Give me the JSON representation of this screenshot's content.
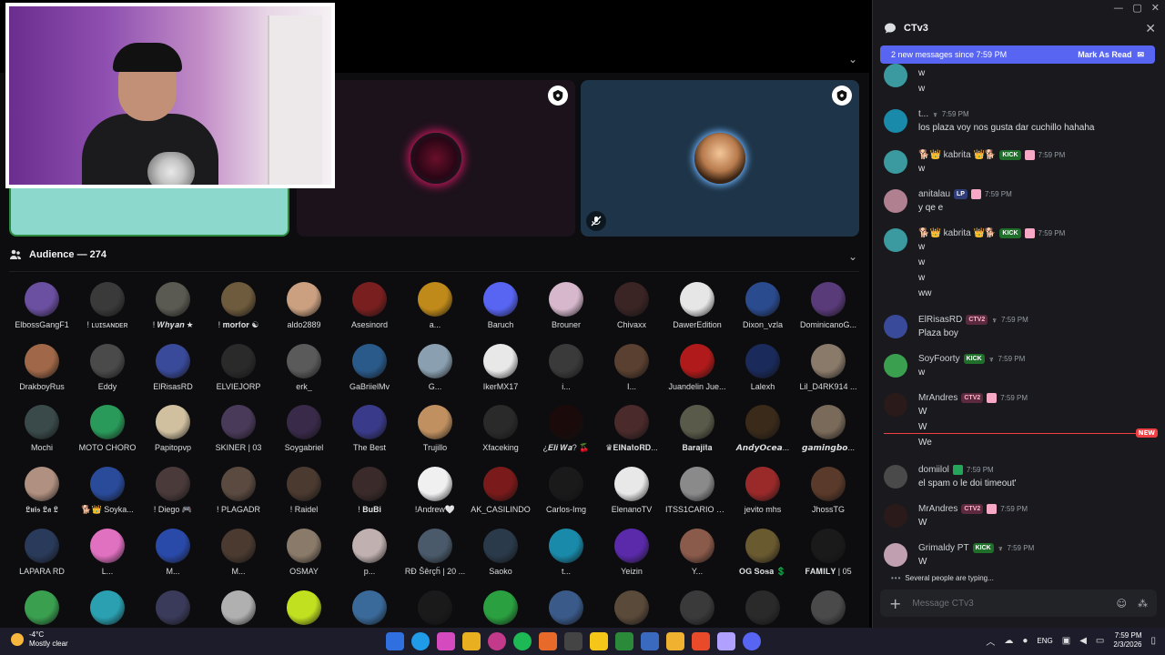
{
  "stage": {
    "audience_title": "Audience — 274"
  },
  "audience": [
    {
      "name": "ElbossGangF1",
      "color": "#6b4fa0"
    },
    {
      "name": "! ʟᴜɪsᴀɴᴅᴇʀ",
      "color": "#3a3a3a"
    },
    {
      "name": "! 𝑾𝒉𝒚𝒂𝒏 ★",
      "color": "#5a5a52"
    },
    {
      "name": "! 𝐦𝐨𝐫𝐟𝐨𝐫 ☯",
      "color": "#6e5a3c"
    },
    {
      "name": "aldo2889",
      "color": "#caa080"
    },
    {
      "name": "Asesinord",
      "color": "#7a1f1f"
    },
    {
      "name": "a...",
      "color": "#c08a1a"
    },
    {
      "name": "Baruch",
      "color": "#5865f2"
    },
    {
      "name": "Brouner",
      "color": "#d6b7cc"
    },
    {
      "name": "Chivaxx",
      "color": "#3a2424"
    },
    {
      "name": "DawerEdition",
      "color": "#e6e6e6"
    },
    {
      "name": "Dixon_vzla",
      "color": "#2b4b8f"
    },
    {
      "name": "DominicanoG...",
      "color": "#5a3b7a"
    },
    {
      "name": "DrakboyRus",
      "color": "#a06848"
    },
    {
      "name": "Eddy",
      "color": "#4a4a4a"
    },
    {
      "name": "ElRisasRD",
      "color": "#3a4a9a"
    },
    {
      "name": "ELVIEJORP",
      "color": "#2a2a2a"
    },
    {
      "name": "erk_",
      "color": "#5a5a5a"
    },
    {
      "name": "GaBriielMv",
      "color": "#2a5a8a"
    },
    {
      "name": "G...",
      "color": "#8aa0b0"
    },
    {
      "name": "IkerMX17",
      "color": "#e8e8e8"
    },
    {
      "name": "i...",
      "color": "#3a3a3a"
    },
    {
      "name": "I...",
      "color": "#5a4030"
    },
    {
      "name": "Juandelin Jue...",
      "color": "#b01a1a"
    },
    {
      "name": "Lalexh",
      "color": "#1a2a5a"
    },
    {
      "name": "Lil_D4RK914 ...",
      "color": "#8a7a6a"
    },
    {
      "name": "Mochi",
      "color": "#3a4a4a"
    },
    {
      "name": "MOTO CHORO",
      "color": "#2a9a5a"
    },
    {
      "name": "Papitopvp",
      "color": "#d0c0a0"
    },
    {
      "name": "SKINER | 03",
      "color": "#4a3a5a"
    },
    {
      "name": "Soygabriel",
      "color": "#3a2a4a"
    },
    {
      "name": "The Best",
      "color": "#3a3a8a"
    },
    {
      "name": "Trujillo",
      "color": "#c09060"
    },
    {
      "name": "Xfaceking",
      "color": "#2a2a2a"
    },
    {
      "name": "¿𝑬𝒍𝒊 𝑾𝒂? 🍒",
      "color": "#1a0a0a"
    },
    {
      "name": "♛𝐄𝐥𝐍𝐚𝐭𝐨𝐑𝐃...",
      "color": "#4a2a2a"
    },
    {
      "name": "𝐁𝐚𝐫𝐚𝐣𝐢𝐭𝐚",
      "color": "#5a5a4a"
    },
    {
      "name": "𝘼𝙣𝙙𝙮𝙊𝙘𝙚𝙖...",
      "color": "#3a2a1a"
    },
    {
      "name": "𝙜𝙖𝙢𝙞𝙣𝙜𝙗𝙤...",
      "color": "#7a6a5a"
    },
    {
      "name": "𝕷𝖚𝖎𝖘 𝕷𝖆 𝕷",
      "color": "#b09080"
    },
    {
      "name": "🐕👑 Soyka...",
      "color": "#2a4a9a"
    },
    {
      "name": "! Diego 🎮",
      "color": "#4a3a3a"
    },
    {
      "name": "! PLAGADR",
      "color": "#5a4a40"
    },
    {
      "name": "! Raidel",
      "color": "#4a3a30"
    },
    {
      "name": "! 𝐁𝐮𝐁𝐢",
      "color": "#3a2a2a"
    },
    {
      "name": "!Andrew🤍",
      "color": "#f0f0f0"
    },
    {
      "name": "AK_CASILINDO",
      "color": "#7a1a1a"
    },
    {
      "name": "Carlos-Img",
      "color": "#1a1a1a"
    },
    {
      "name": "ElenanoTV",
      "color": "#e8e8e8"
    },
    {
      "name": "ITSS1CARIO O...",
      "color": "#8a8a8a"
    },
    {
      "name": "jevito mhs",
      "color": "#9a2a2a"
    },
    {
      "name": "JhossTG",
      "color": "#5a3a2a"
    },
    {
      "name": "LAPARA RD",
      "color": "#2a3a5a"
    },
    {
      "name": "L...",
      "color": "#e070c0"
    },
    {
      "name": "M...",
      "color": "#2a4aaa"
    },
    {
      "name": "M...",
      "color": "#4a3a30"
    },
    {
      "name": "OSMAY",
      "color": "#8a7a6a"
    },
    {
      "name": "p...",
      "color": "#c0b0b0"
    },
    {
      "name": "RĐ Šêrçĥ | 20 ...",
      "color": "#4a5a6a"
    },
    {
      "name": "Saoko",
      "color": "#2a3a4a"
    },
    {
      "name": "t...",
      "color": "#1a8aaa"
    },
    {
      "name": "Yeizin",
      "color": "#5a2aaa"
    },
    {
      "name": "Y...",
      "color": "#8a5a4a"
    },
    {
      "name": "𝐎𝐆 𝐒𝐨𝐬𝐚 💲",
      "color": "#6a5a30"
    },
    {
      "name": "𝐅𝐀𝐌𝐈𝐋𝐘 | 05",
      "color": "#1a1a1a"
    },
    {
      "name": "...",
      "color": "#3aa050"
    },
    {
      "name": "...",
      "color": "#2aa0b0"
    },
    {
      "name": "...",
      "color": "#3a3a5a"
    },
    {
      "name": "...",
      "color": "#b0b0b0"
    },
    {
      "name": "...",
      "color": "#c0e020"
    },
    {
      "name": "...",
      "color": "#3a6a9a"
    },
    {
      "name": "...",
      "color": "#1a1a1a"
    },
    {
      "name": "...",
      "color": "#2aa040"
    },
    {
      "name": "...",
      "color": "#3a5a8a"
    },
    {
      "name": "...",
      "color": "#5a4a3a"
    },
    {
      "name": "...",
      "color": "#3a3a3a"
    },
    {
      "name": "...",
      "color": "#2a2a2a"
    },
    {
      "name": "...",
      "color": "#4a4a4a"
    }
  ],
  "chat": {
    "channel": "CTv3",
    "banner_text": "2 new messages since 7:59 PM",
    "banner_action": "Mark As Read",
    "new_label": "NEW",
    "typing_text": "Several people are typing...",
    "composer_placeholder": "Message CTv3",
    "messages": [
      {
        "user": "",
        "time": "",
        "lines": [
          "w",
          "w"
        ],
        "avatar": "#3a9aa0",
        "badges": []
      },
      {
        "user": "t...",
        "time": "7:59 PM",
        "lines": [
          "los plaza voy nos gusta dar cuchillo hahaha"
        ],
        "avatar": "#1a8aaa",
        "badges": [
          "crown"
        ]
      },
      {
        "user": "🐕👑 kabrita 👑🐕",
        "time": "7:59 PM",
        "lines": [
          "w"
        ],
        "avatar": "#3a9aa0",
        "badges": [
          "kick",
          "pink"
        ]
      },
      {
        "user": "anitalau",
        "time": "7:59 PM",
        "lines": [
          "y qe e"
        ],
        "avatar": "#b08090",
        "badges": [
          "lp",
          "pink"
        ]
      },
      {
        "user": "🐕👑 kabrita 👑🐕",
        "time": "7:59 PM",
        "lines": [
          "w",
          "w",
          "w",
          "ww"
        ],
        "avatar": "#3a9aa0",
        "badges": [
          "kick",
          "pink"
        ]
      },
      {
        "user": "ElRisasRD",
        "time": "7:59 PM",
        "lines": [
          "Plaza boy"
        ],
        "avatar": "#3a4a9a",
        "badges": [
          "ctv2",
          "crown"
        ]
      },
      {
        "user": "SoyFoorty",
        "time": "7:59 PM",
        "lines": [
          "w"
        ],
        "avatar": "#3aa050",
        "badges": [
          "kick",
          "crown"
        ]
      },
      {
        "user": "MrAndres",
        "time": "7:59 PM",
        "lines": [
          "W",
          "W",
          "We"
        ],
        "avatar": "#2a1a1a",
        "badges": [
          "ctv2",
          "pink"
        ]
      },
      {
        "user": "domiilol",
        "time": "7:59 PM",
        "lines": [
          "el spam  o  le  doi  timeout'"
        ],
        "avatar": "#4a4a4a",
        "badges": [
          "green"
        ]
      },
      {
        "user": "MrAndres",
        "time": "7:59 PM",
        "lines": [
          "W"
        ],
        "avatar": "#2a1a1a",
        "badges": [
          "ctv2",
          "pink"
        ]
      },
      {
        "user": "Grimaldy PT",
        "time": "7:59 PM",
        "lines": [
          "W"
        ],
        "avatar": "#c0a0b0",
        "badges": [
          "kick",
          "crown"
        ]
      }
    ]
  },
  "badge_labels": {
    "kick": "KICK",
    "ctv2": "CTV2",
    "lp": "LP"
  },
  "taskbar": {
    "temp": "-4°C",
    "weather": "Mostly clear",
    "lang": "ENG",
    "time": "7:59 PM",
    "date": "2/3/2026"
  }
}
